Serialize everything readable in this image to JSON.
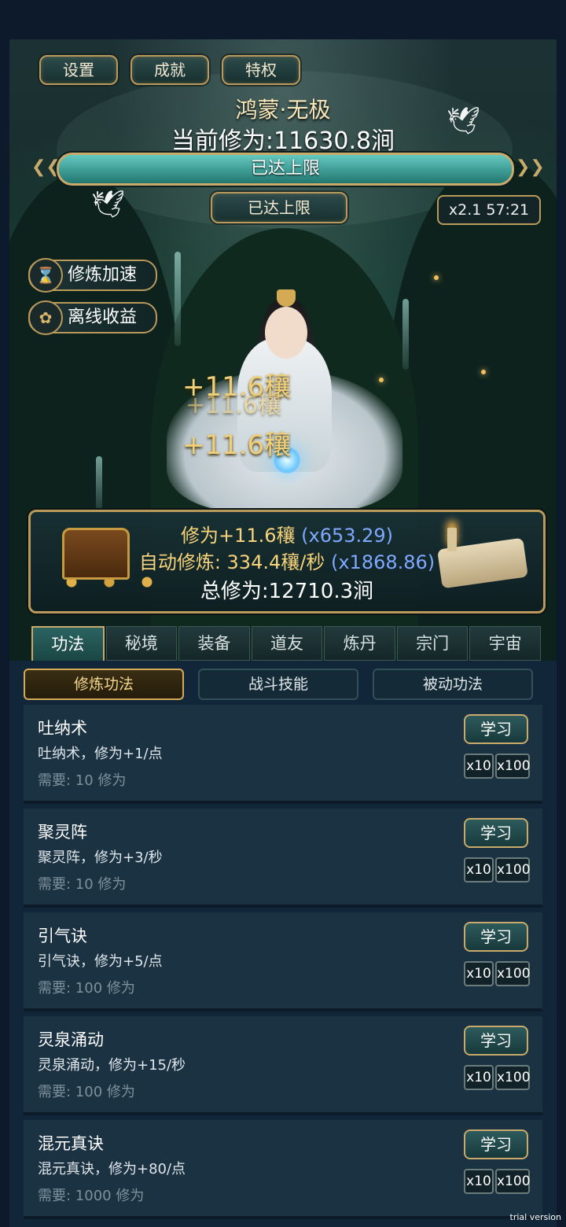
{
  "top_buttons": {
    "settings": "设置",
    "achievements": "成就",
    "privileges": "特权"
  },
  "realm": {
    "name": "鸿蒙·无极",
    "current_cultivation": "当前修为:11630.8涧"
  },
  "progress": {
    "label": "已达上限",
    "fill": 1.0
  },
  "status_badge": "已达上限",
  "multiplier_timer": "x2.1 57:21",
  "side_buttons": {
    "speedup": "修炼加速",
    "offline": "离线收益"
  },
  "floating_gains": [
    "+11.6穰",
    "+11.6穰",
    "+11.6穰"
  ],
  "info": {
    "gain_label": "修为+11.6穰",
    "gain_mult": "(x653.29)",
    "auto_label": "自动修炼: 334.4穰/秒",
    "auto_mult": "(x1868.86)",
    "total": "总修为:12710.3涧"
  },
  "main_tabs": [
    "功法",
    "秘境",
    "装备",
    "道友",
    "炼丹",
    "宗门",
    "宇宙"
  ],
  "sub_tabs": [
    "修炼功法",
    "战斗技能",
    "被动功法"
  ],
  "techniques": [
    {
      "name": "吐纳术",
      "desc": "吐纳术，修为+1/点",
      "req": "需要: 10 修为",
      "learn": "学习",
      "x10": "x10",
      "x100": "x100"
    },
    {
      "name": "聚灵阵",
      "desc": "聚灵阵，修为+3/秒",
      "req": "需要: 10 修为",
      "learn": "学习",
      "x10": "x10",
      "x100": "x100"
    },
    {
      "name": "引气诀",
      "desc": "引气诀，修为+5/点",
      "req": "需要: 100 修为",
      "learn": "学习",
      "x10": "x10",
      "x100": "x100"
    },
    {
      "name": "灵泉涌动",
      "desc": "灵泉涌动，修为+15/秒",
      "req": "需要: 100 修为",
      "learn": "学习",
      "x10": "x10",
      "x100": "x100"
    },
    {
      "name": "混元真诀",
      "desc": "混元真诀，修为+80/点",
      "req": "需要: 1000 修为",
      "learn": "学习",
      "x10": "x10",
      "x100": "x100"
    }
  ],
  "watermark": "trial version",
  "colors": {
    "gold": "#c9aa6a",
    "teal": "#2f8c86",
    "blue_mult": "#7fa8ff",
    "panel": "#1b3243"
  }
}
